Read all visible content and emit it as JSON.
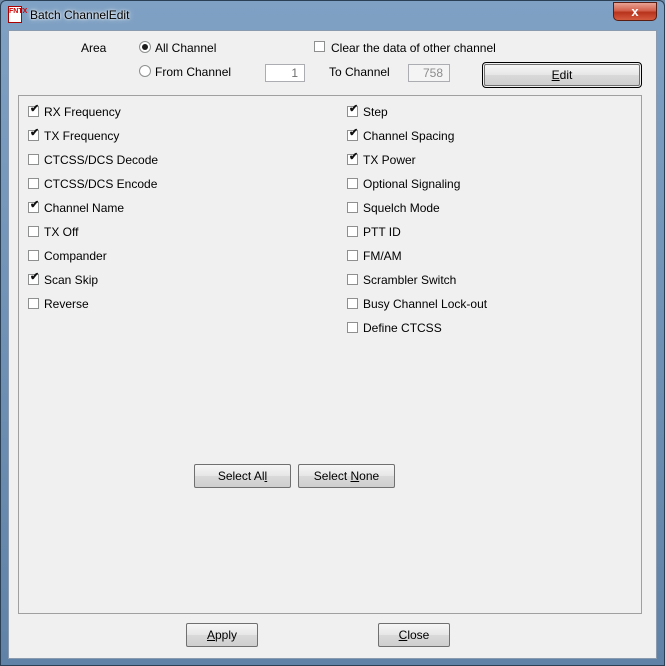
{
  "window": {
    "title": "Batch ChannelEdit",
    "close_glyph": "x",
    "app_icon_text": "FNTX"
  },
  "area": {
    "label": "Area",
    "all_channel_label": "All Channel",
    "from_channel_label": "From Channel",
    "from_value": "1",
    "to_channel_label": "To Channel",
    "to_value": "758",
    "clear_label": "Clear the data of other channel",
    "selected": "All Channel",
    "clear_checked": false
  },
  "buttons": {
    "edit": {
      "pre": "",
      "accel": "E",
      "post": "dit"
    },
    "select_all": {
      "pre": "Select Al",
      "accel": "l",
      "post": ""
    },
    "select_none": {
      "pre": "Select ",
      "accel": "N",
      "post": "one"
    },
    "apply": {
      "pre": "",
      "accel": "A",
      "post": "pply"
    },
    "close": {
      "pre": "",
      "accel": "C",
      "post": "lose"
    }
  },
  "fields_left": [
    {
      "label": "RX Frequency",
      "checked": true
    },
    {
      "label": "TX Frequency",
      "checked": true
    },
    {
      "label": "CTCSS/DCS Decode",
      "checked": false
    },
    {
      "label": "CTCSS/DCS Encode",
      "checked": false
    },
    {
      "label": "Channel Name",
      "checked": true
    },
    {
      "label": "TX Off",
      "checked": false
    },
    {
      "label": "Compander",
      "checked": false
    },
    {
      "label": "Scan Skip",
      "checked": true
    },
    {
      "label": "Reverse",
      "checked": false
    }
  ],
  "fields_right": [
    {
      "label": "Step",
      "checked": true
    },
    {
      "label": "Channel Spacing",
      "checked": true
    },
    {
      "label": "TX Power",
      "checked": true
    },
    {
      "label": "Optional Signaling",
      "checked": false
    },
    {
      "label": "Squelch Mode",
      "checked": false
    },
    {
      "label": "PTT ID",
      "checked": false
    },
    {
      "label": "FM/AM",
      "checked": false
    },
    {
      "label": "Scrambler Switch",
      "checked": false
    },
    {
      "label": "Busy Channel Lock-out",
      "checked": false
    },
    {
      "label": "Define CTCSS",
      "checked": false
    }
  ],
  "check_glyph": "✔"
}
